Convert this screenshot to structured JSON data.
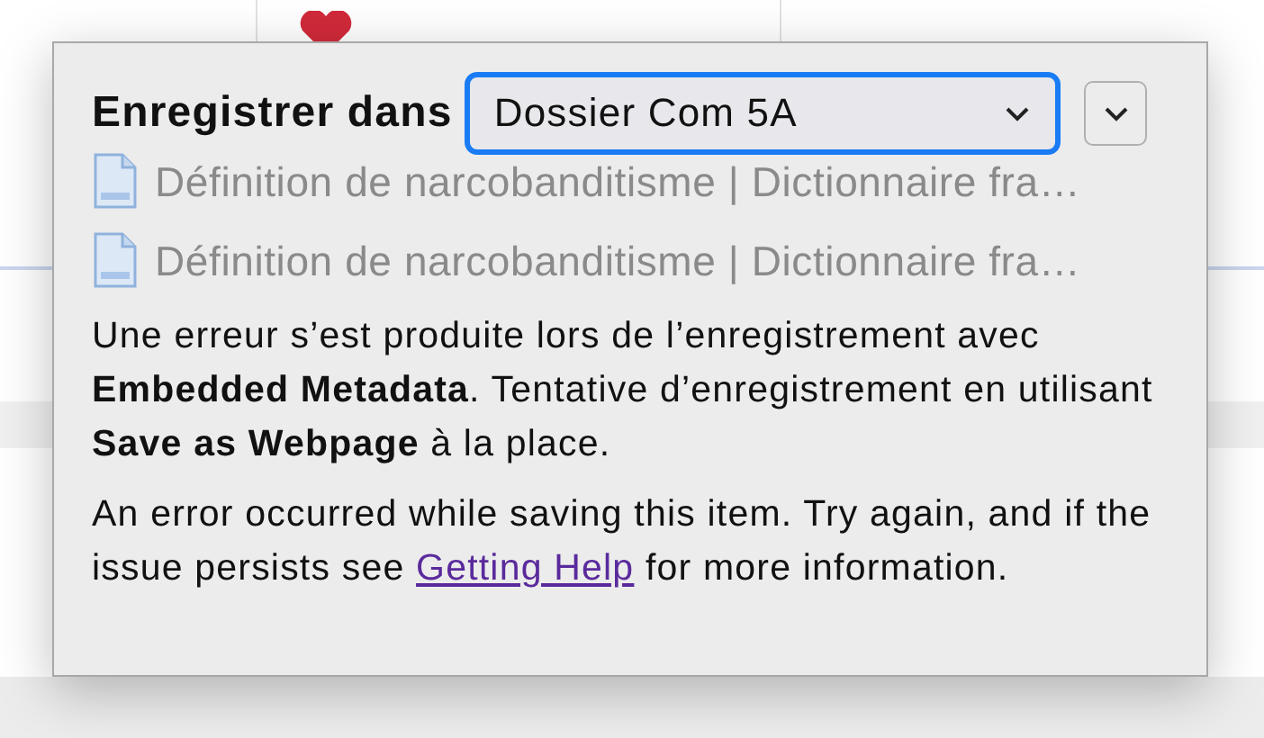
{
  "popup": {
    "label": "Enregistrer dans",
    "folder": "Dossier Com 5A",
    "items": [
      {
        "title": "Définition de narcobanditisme | Dictionnaire fra…"
      },
      {
        "title": "Définition de narcobanditisme | Dictionnaire fra…"
      }
    ],
    "error": "Une erreur s’est produite lors de l’enregistrement avec **Embedded Metadata**. Tentative d’enregistrement en utilisant **Save as Webpage** à la place.",
    "help_before": "An error occurred while saving this item. Try again, and if the issue persists see",
    "help_link": "Getting Help",
    "help_after": "for more information."
  }
}
